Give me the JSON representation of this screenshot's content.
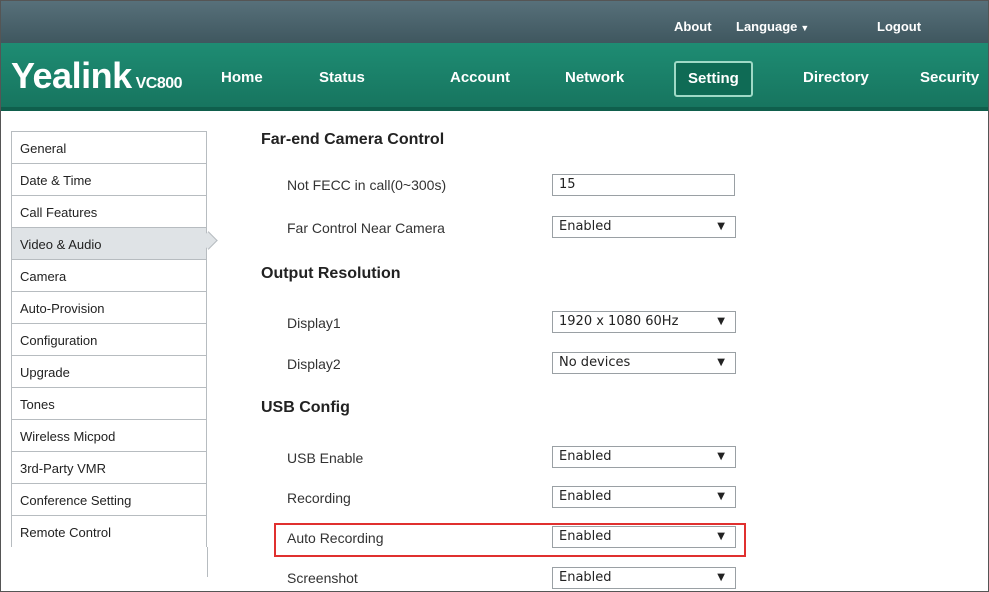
{
  "topbar": {
    "about": "About",
    "language": "Language",
    "logout": "Logout"
  },
  "brand": {
    "name": "Yealink",
    "model": "VC800"
  },
  "nav": {
    "home": "Home",
    "status": "Status",
    "account": "Account",
    "network": "Network",
    "setting": "Setting",
    "directory": "Directory",
    "security": "Security"
  },
  "sidebar": {
    "items": [
      {
        "label": "General"
      },
      {
        "label": "Date & Time"
      },
      {
        "label": "Call Features"
      },
      {
        "label": "Video & Audio"
      },
      {
        "label": "Camera"
      },
      {
        "label": "Auto-Provision"
      },
      {
        "label": "Configuration"
      },
      {
        "label": "Upgrade"
      },
      {
        "label": "Tones"
      },
      {
        "label": "Wireless Micpod"
      },
      {
        "label": "3rd-Party VMR"
      },
      {
        "label": "Conference Setting"
      },
      {
        "label": "Remote Control"
      }
    ],
    "active_index": 3
  },
  "sections": {
    "fecc": {
      "title": "Far-end Camera Control",
      "not_fecc_label": "Not FECC in call(0~300s)",
      "not_fecc_value": "15",
      "far_control_label": "Far Control Near Camera",
      "far_control_value": "Enabled"
    },
    "output": {
      "title": "Output Resolution",
      "display1_label": "Display1",
      "display1_value": "1920 x 1080 60Hz",
      "display2_label": "Display2",
      "display2_value": "No devices"
    },
    "usb": {
      "title": "USB Config",
      "usb_enable_label": "USB Enable",
      "usb_enable_value": "Enabled",
      "recording_label": "Recording",
      "recording_value": "Enabled",
      "auto_recording_label": "Auto Recording",
      "auto_recording_value": "Enabled",
      "screenshot_label": "Screenshot",
      "screenshot_value": "Enabled"
    }
  },
  "colors": {
    "nav_green": "#1e8c73",
    "topbar": "#4a626b",
    "highlight": "#e0302f"
  }
}
